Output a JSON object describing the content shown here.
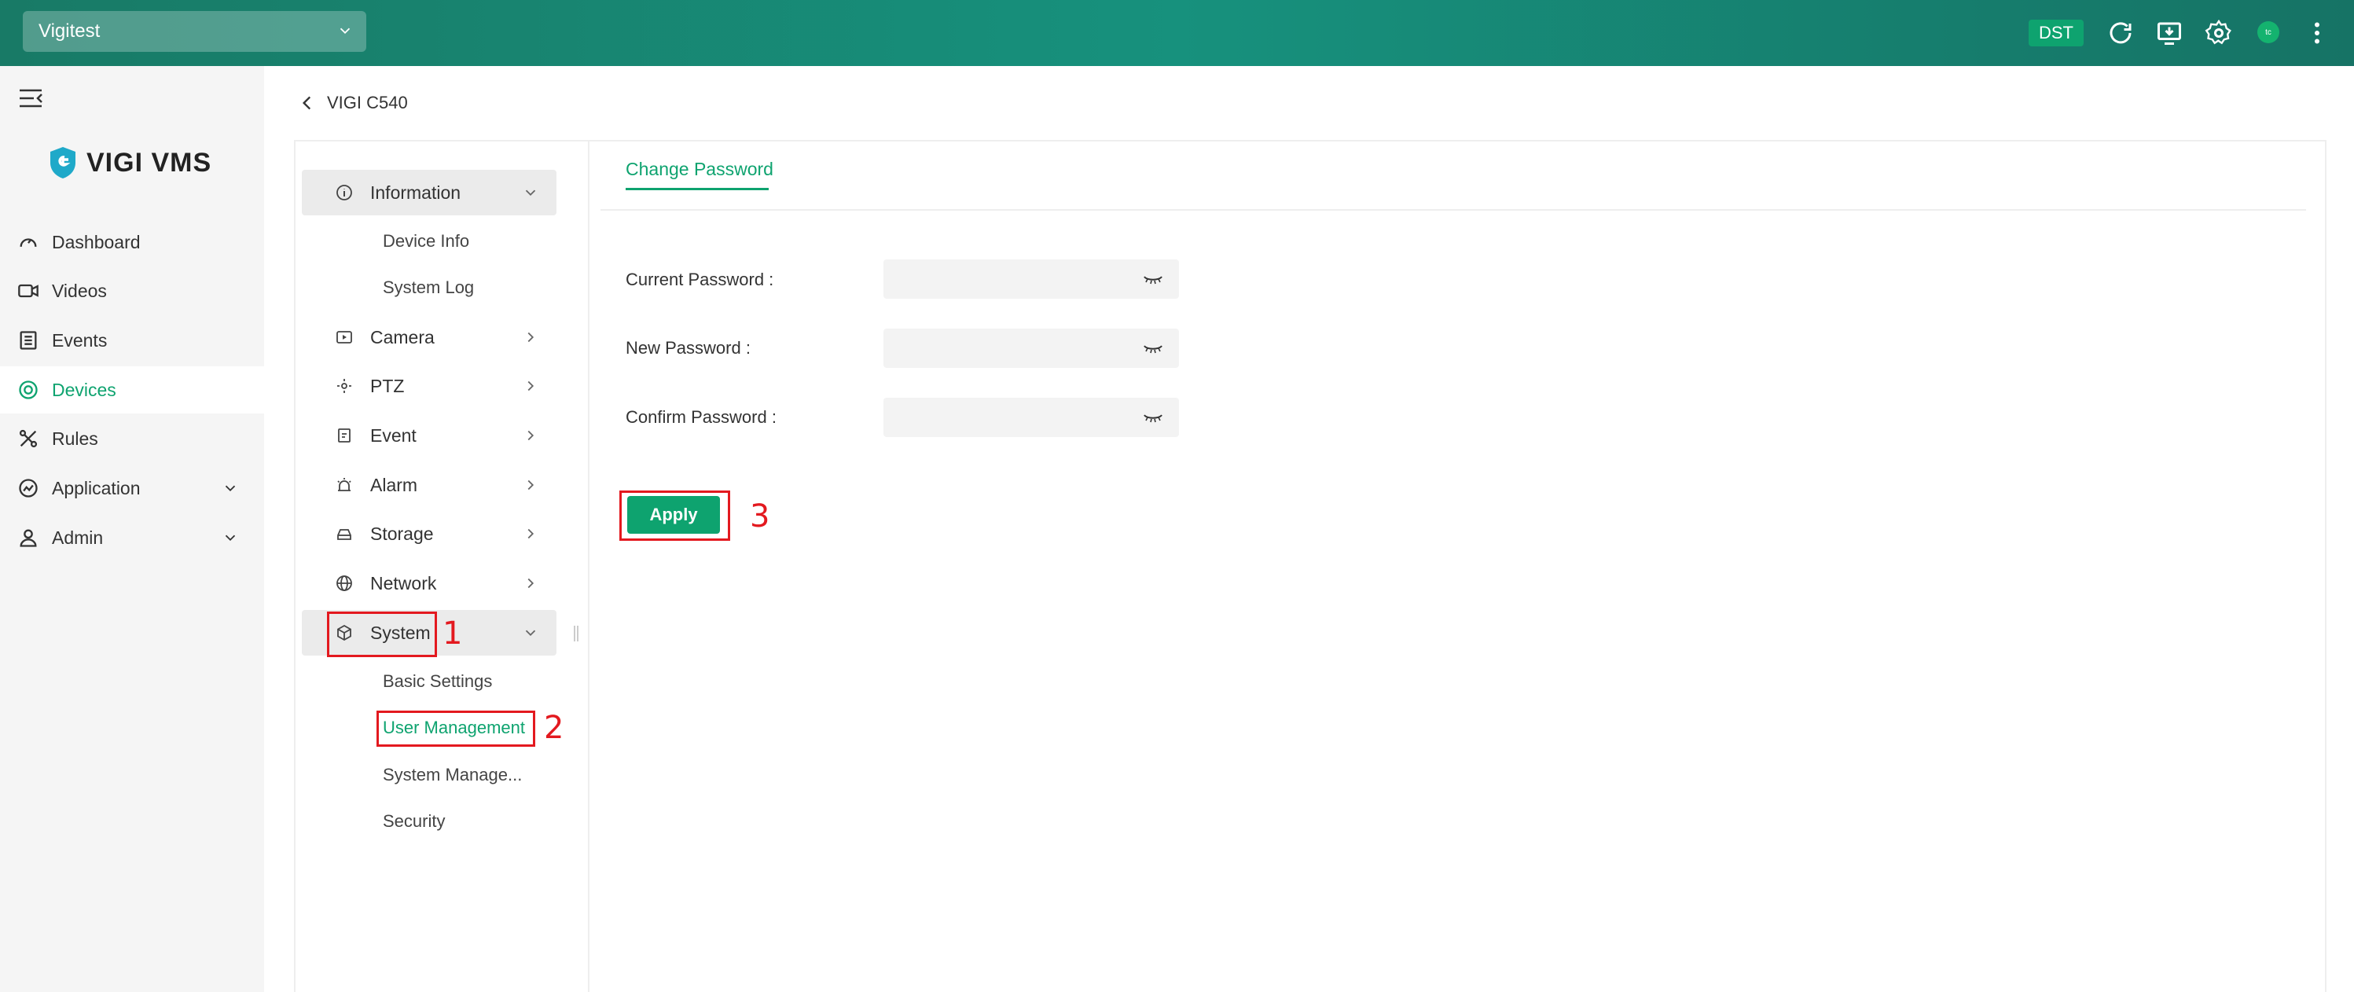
{
  "topbar": {
    "site_name": "Vigitest",
    "dst_label": "DST",
    "avatar_initials": "tc",
    "icons": [
      "refresh-icon",
      "download-icon",
      "settings-icon",
      "avatar",
      "more-icon"
    ]
  },
  "sidebar": {
    "logo_text": "VIGI VMS",
    "items": [
      {
        "label": "Dashboard",
        "icon": "dashboard-icon"
      },
      {
        "label": "Videos",
        "icon": "video-icon"
      },
      {
        "label": "Events",
        "icon": "events-icon"
      },
      {
        "label": "Devices",
        "icon": "devices-icon",
        "active": true
      },
      {
        "label": "Rules",
        "icon": "rules-icon"
      },
      {
        "label": "Application",
        "icon": "application-icon",
        "expandable": true
      },
      {
        "label": "Admin",
        "icon": "admin-icon",
        "expandable": true
      }
    ]
  },
  "device": {
    "back_label": "VIGI C540"
  },
  "settings_menu": {
    "information": {
      "label": "Information",
      "children": [
        "Device Info",
        "System Log"
      ]
    },
    "camera": {
      "label": "Camera"
    },
    "ptz": {
      "label": "PTZ"
    },
    "event": {
      "label": "Event"
    },
    "alarm": {
      "label": "Alarm"
    },
    "storage": {
      "label": "Storage"
    },
    "network": {
      "label": "Network"
    },
    "system": {
      "label": "System",
      "children": [
        "Basic Settings",
        "User Management",
        "System Manage...",
        "Security"
      ]
    }
  },
  "content": {
    "tab_label": "Change Password",
    "fields": [
      {
        "label": "Current Password :",
        "value": ""
      },
      {
        "label": "New Password :",
        "value": ""
      },
      {
        "label": "Confirm Password :",
        "value": ""
      }
    ],
    "apply_label": "Apply"
  },
  "annotations": [
    "1",
    "2",
    "3"
  ],
  "colors": {
    "accent": "#0ea36f",
    "topbar": "#17917d",
    "annotation": "#e3191f"
  }
}
